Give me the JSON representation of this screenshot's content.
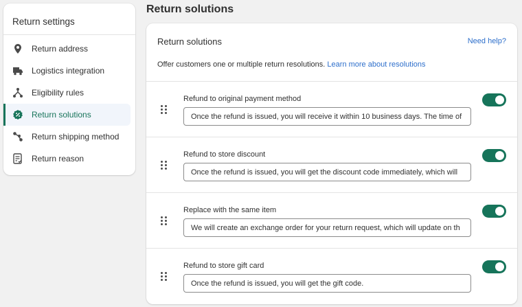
{
  "sidebar": {
    "title": "Return settings",
    "items": [
      {
        "label": "Return address",
        "icon": "location-pin-icon"
      },
      {
        "label": "Logistics integration",
        "icon": "truck-icon"
      },
      {
        "label": "Eligibility rules",
        "icon": "network-icon"
      },
      {
        "label": "Return solutions",
        "icon": "discount-badge-icon",
        "active": true
      },
      {
        "label": "Return shipping method",
        "icon": "shipping-route-icon"
      },
      {
        "label": "Return reason",
        "icon": "checklist-icon"
      }
    ]
  },
  "main": {
    "page_title": "Return solutions",
    "card": {
      "title": "Return solutions",
      "need_help": "Need help?",
      "description": "Offer customers one or multiple return resolutions.",
      "learn_more": "Learn more about resolutions",
      "solutions": [
        {
          "label": "Refund to original payment method",
          "value": "Once the refund is issued, you will receive it within 10 business days. The time of",
          "enabled": true
        },
        {
          "label": "Refund to store discount",
          "value": "Once the refund is issued, you will get the discount code immediately, which will",
          "enabled": true
        },
        {
          "label": "Replace with the same item",
          "value": "We will create an exchange order for your return request, which will update on th",
          "enabled": true
        },
        {
          "label": "Refund to store gift card",
          "value": "Once the refund is issued, you will get the gift code.",
          "enabled": true
        }
      ]
    }
  },
  "colors": {
    "accent": "#16745a",
    "link": "#2c6ecb",
    "active_bg": "#f1f5fb"
  }
}
